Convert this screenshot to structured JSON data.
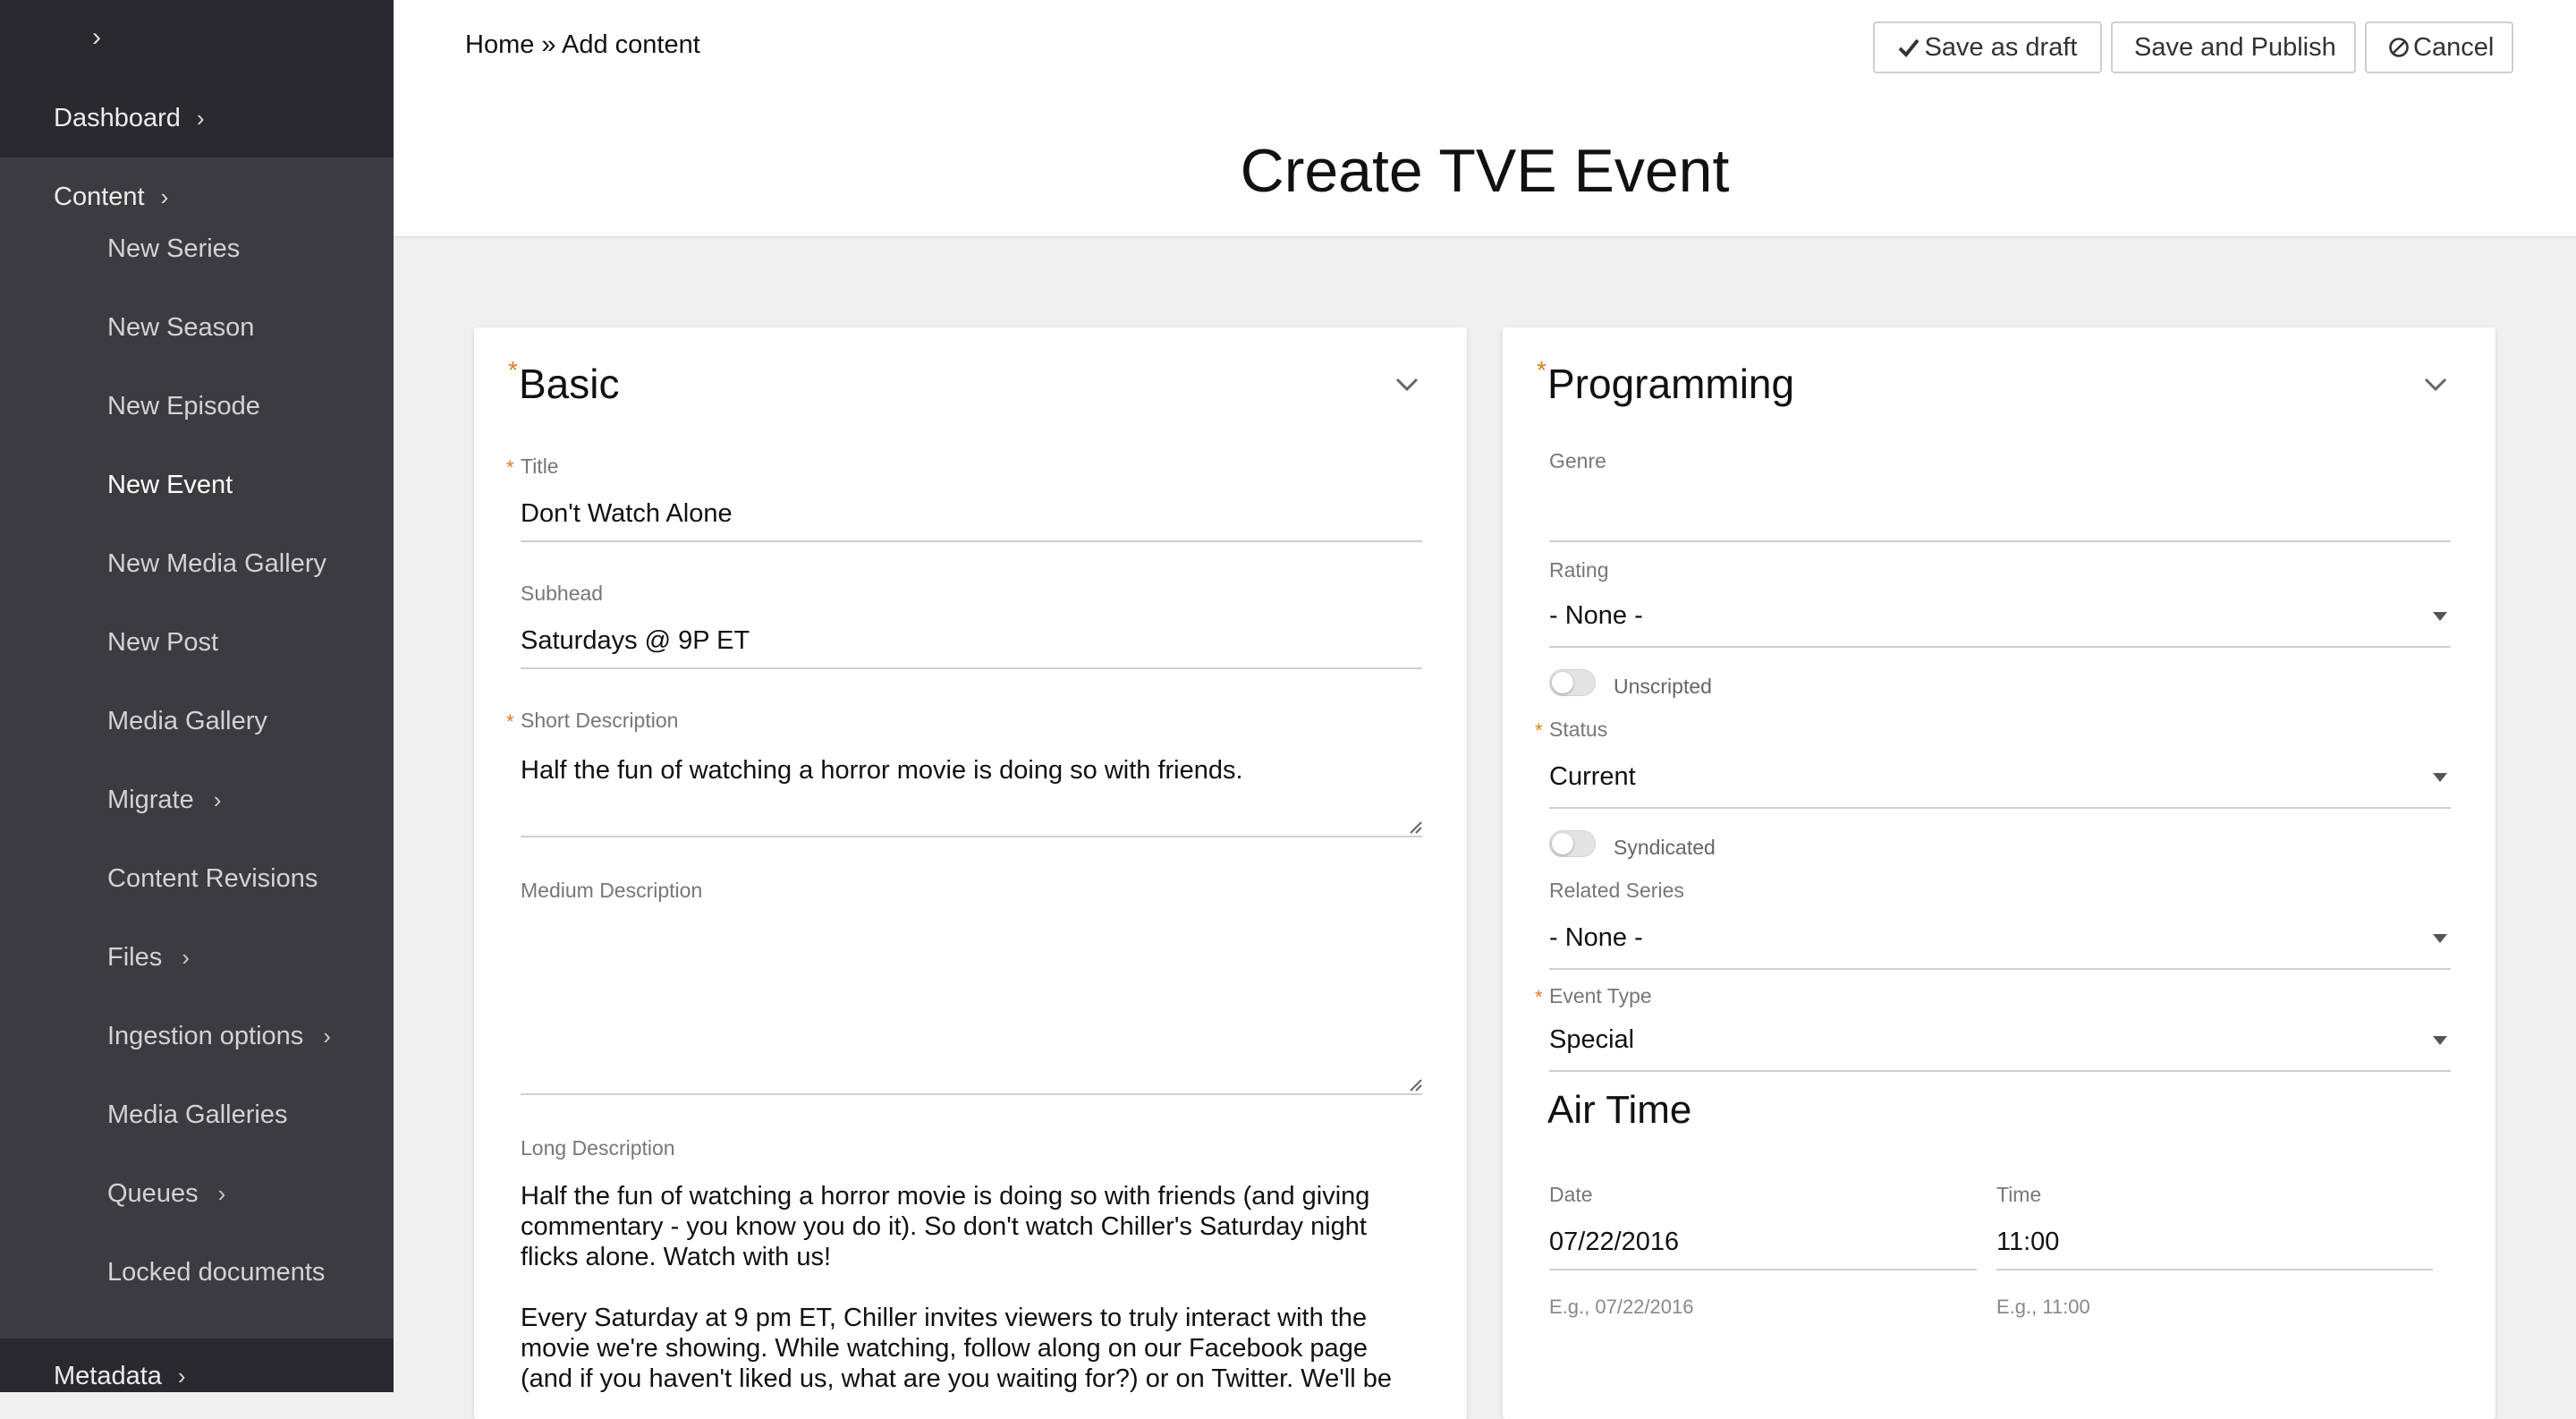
{
  "sidebar": {
    "toggle_icon": "›",
    "dashboard_label": "Dashboard",
    "content_label": "Content",
    "items": [
      {
        "label": "New Series"
      },
      {
        "label": "New Season"
      },
      {
        "label": "New Episode"
      },
      {
        "label": "New Event"
      },
      {
        "label": "New Media Gallery"
      },
      {
        "label": "New Post"
      },
      {
        "label": "Media Gallery"
      },
      {
        "label": "Migrate"
      },
      {
        "label": "Content Revisions"
      },
      {
        "label": "Files"
      },
      {
        "label": "Ingestion options"
      },
      {
        "label": "Media Galleries"
      },
      {
        "label": "Queues"
      },
      {
        "label": "Locked documents"
      }
    ],
    "metadata_label": "Metadata",
    "chevron": "›"
  },
  "header": {
    "breadcrumb": "Home » Add content",
    "buttons": {
      "save_draft": "Save as draft",
      "save_publish": "Save and Publish",
      "cancel": "Cancel"
    },
    "page_title": "Create TVE Event"
  },
  "basic": {
    "title": "Basic",
    "required_mark": "*",
    "fields": {
      "title_label": "Title",
      "title_value": "Don't Watch Alone",
      "subhead_label": "Subhead",
      "subhead_value": "Saturdays @ 9P ET",
      "short_desc_label": "Short Description",
      "short_desc_value": "Half the fun of watching a horror movie is doing so with friends.",
      "medium_desc_label": "Medium Description",
      "medium_desc_value": "",
      "long_desc_label": "Long Description",
      "long_desc_p1": "Half the fun of watching a horror movie is doing so with friends (and giving commentary - you know you do it). So don't watch Chiller's Saturday night flicks alone. Watch with us!",
      "long_desc_p2": "Every Saturday at 9 pm ET, Chiller invites viewers to truly interact with the movie we're showing. While watching, follow along on our Facebook page (and if you haven't liked us, what are you waiting for?) or on Twitter. We'll be"
    }
  },
  "programming": {
    "title": "Programming",
    "required_mark": "*",
    "fields": {
      "genre_label": "Genre",
      "genre_value": "",
      "rating_label": "Rating",
      "rating_value": "- None -",
      "unscripted_label": "Unscripted",
      "status_label": "Status",
      "status_value": "Current",
      "syndicated_label": "Syndicated",
      "related_series_label": "Related Series",
      "related_series_value": "- None -",
      "event_type_label": "Event Type",
      "event_type_value": "Special"
    },
    "air_time": {
      "heading": "Air Time",
      "date_label": "Date",
      "date_value": "07/22/2016",
      "date_hint": "E.g., 07/22/2016",
      "time_label": "Time",
      "time_value": "11:00",
      "time_hint": "E.g., 11:00"
    }
  }
}
